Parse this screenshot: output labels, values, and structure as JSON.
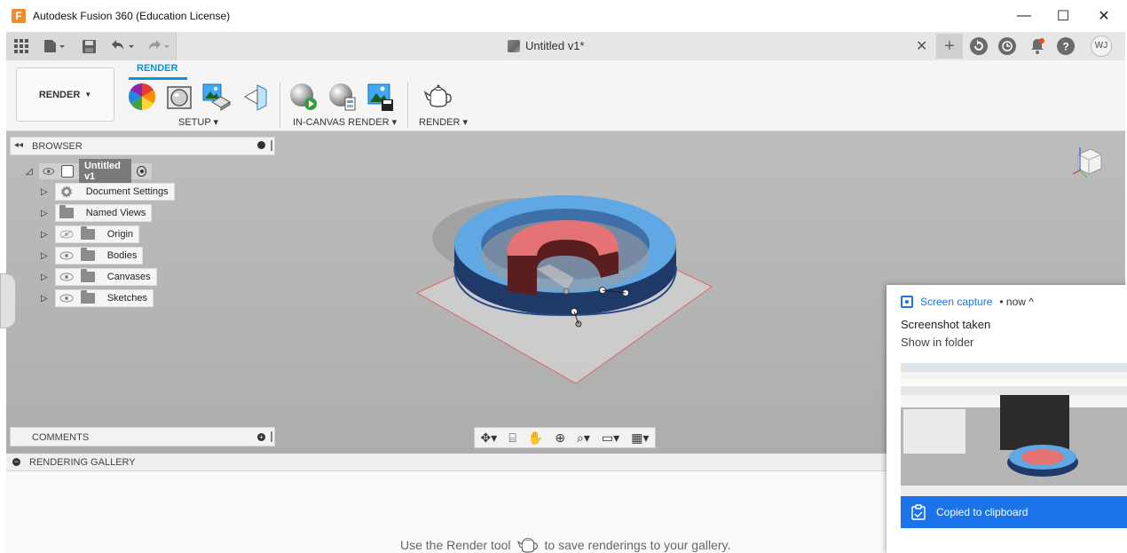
{
  "window": {
    "app_icon": "F",
    "title": "Autodesk Fusion 360 (Education License)",
    "minimize": "—",
    "maximize": "☐",
    "close": "✕"
  },
  "qat": {
    "doc_tab": "Untitled v1*",
    "tab_close": "✕",
    "tab_plus": "+",
    "user_initials": "WJ"
  },
  "ribbon": {
    "workspace": "RENDER",
    "active_tab": "RENDER",
    "groups": [
      "SETUP",
      "IN-CANVAS RENDER",
      "RENDER"
    ]
  },
  "browser": {
    "title": "BROWSER",
    "root": "Untitled v1",
    "items": [
      {
        "label": "Document Settings"
      },
      {
        "label": "Named Views"
      },
      {
        "label": "Origin"
      },
      {
        "label": "Bodies"
      },
      {
        "label": "Canvases"
      },
      {
        "label": "Sketches"
      }
    ]
  },
  "comments": {
    "title": "COMMENTS"
  },
  "gallery": {
    "title": "RENDERING GALLERY",
    "hint_before": "Use the Render tool",
    "hint_after": "to save renderings to your gallery."
  },
  "notification": {
    "source": "Screen capture",
    "time": "• now ^",
    "title": "Screenshot taken",
    "link": "Show in folder",
    "clipboard": "Copied to clipboard"
  },
  "colors": {
    "accent": "#0696d7",
    "notif_blue": "#1a73e8",
    "canvas": "#b3b3b3"
  }
}
